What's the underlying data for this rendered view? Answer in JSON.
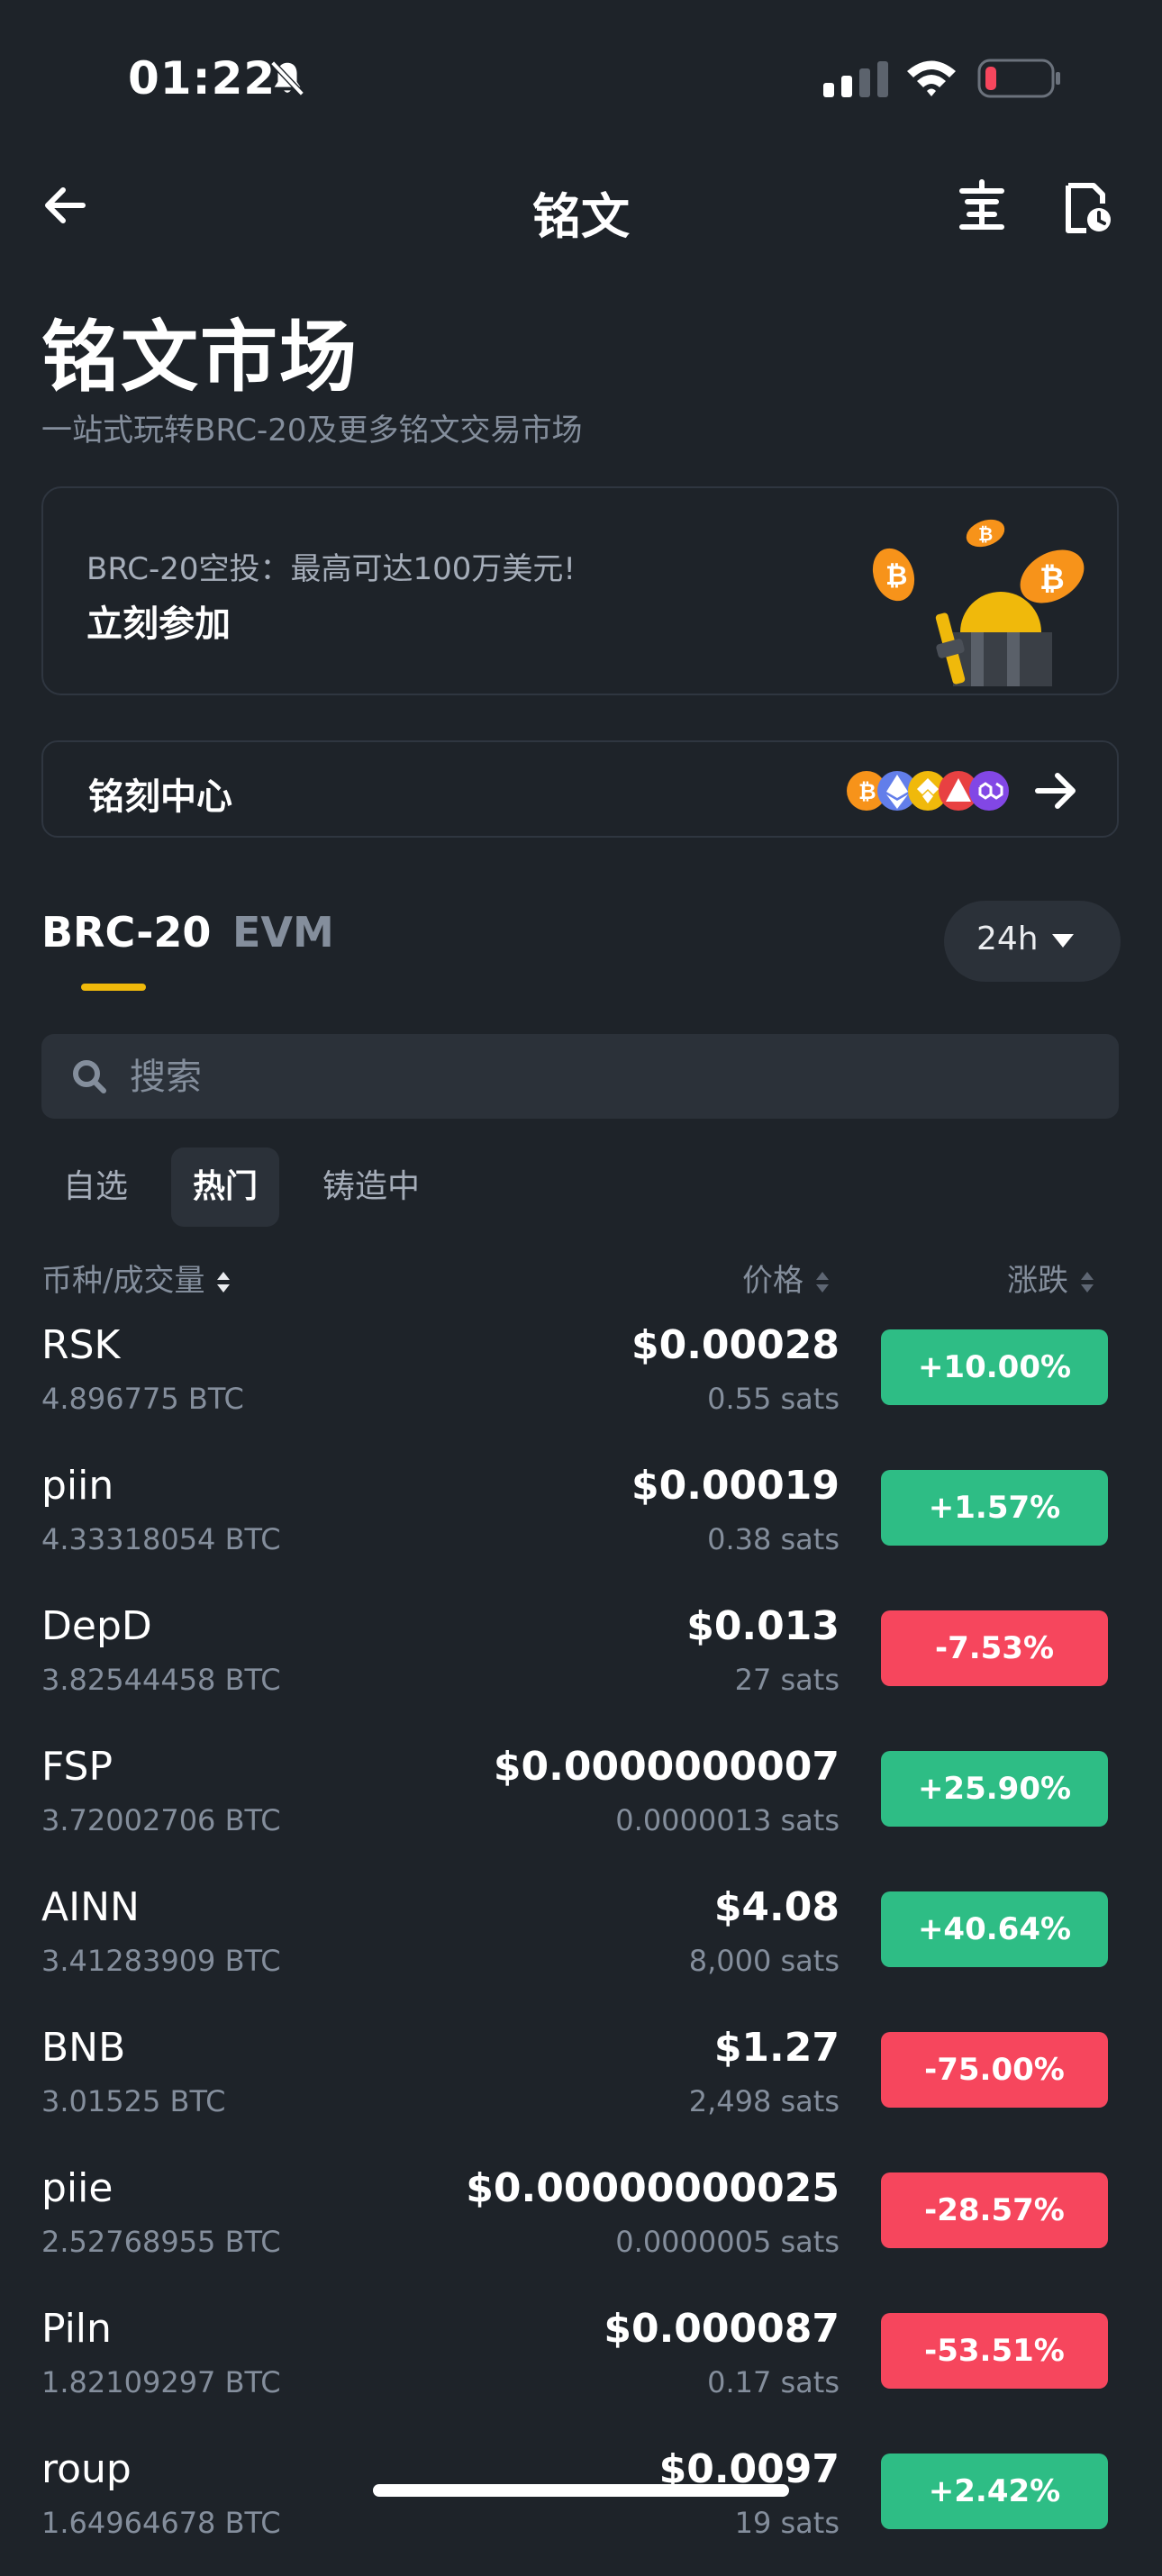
{
  "status_bar": {
    "time": "01:22"
  },
  "header": {
    "title": "铭文"
  },
  "page": {
    "title": "铭文市场",
    "subtitle": "一站式玩转BRC-20及更多铭文交易市场"
  },
  "banner": {
    "line1": "BRC-20空投：最高可达100万美元!",
    "line2": "立刻参加"
  },
  "mint_center": {
    "label": "铭刻中心"
  },
  "tabs": {
    "brc20": "BRC-20",
    "evm": "EVM",
    "active": "BRC-20"
  },
  "period": {
    "label": "24h"
  },
  "search": {
    "placeholder": "搜索"
  },
  "filters": {
    "favorites": "自选",
    "hot": "热门",
    "minting": "铸造中",
    "active": "热门"
  },
  "columns": {
    "coin": "币种/成交量",
    "price": "价格",
    "change": "涨跌"
  },
  "colors": {
    "up": "#2ebd85",
    "down": "#f6465d",
    "accent": "#f0b90b",
    "background": "#1e2329"
  },
  "rows": [
    {
      "name": "RSK",
      "volume": "4.896775 BTC",
      "price": "$0.00028",
      "sats": "0.55 sats",
      "change": "+10.00%",
      "direction": "up"
    },
    {
      "name": "piin",
      "volume": "4.33318054 BTC",
      "price": "$0.00019",
      "sats": "0.38 sats",
      "change": "+1.57%",
      "direction": "up"
    },
    {
      "name": "DepD",
      "volume": "3.82544458 BTC",
      "price": "$0.013",
      "sats": "27 sats",
      "change": "-7.53%",
      "direction": "down"
    },
    {
      "name": "FSP",
      "volume": "3.72002706 BTC",
      "price": "$0.0000000007",
      "sats": "0.0000013 sats",
      "change": "+25.90%",
      "direction": "up"
    },
    {
      "name": "AINN",
      "volume": "3.41283909 BTC",
      "price": "$4.08",
      "sats": "8,000 sats",
      "change": "+40.64%",
      "direction": "up"
    },
    {
      "name": "BNB",
      "volume": "3.01525 BTC",
      "price": "$1.27",
      "sats": "2,498 sats",
      "change": "-75.00%",
      "direction": "down"
    },
    {
      "name": "piie",
      "volume": "2.52768955 BTC",
      "price": "$0.00000000025",
      "sats": "0.0000005 sats",
      "change": "-28.57%",
      "direction": "down"
    },
    {
      "name": "Piln",
      "volume": "1.82109297 BTC",
      "price": "$0.000087",
      "sats": "0.17 sats",
      "change": "-53.51%",
      "direction": "down"
    },
    {
      "name": "roup",
      "volume": "1.64964678 BTC",
      "price": "$0.0097",
      "sats": "19 sats",
      "change": "+2.42%",
      "direction": "up"
    }
  ]
}
